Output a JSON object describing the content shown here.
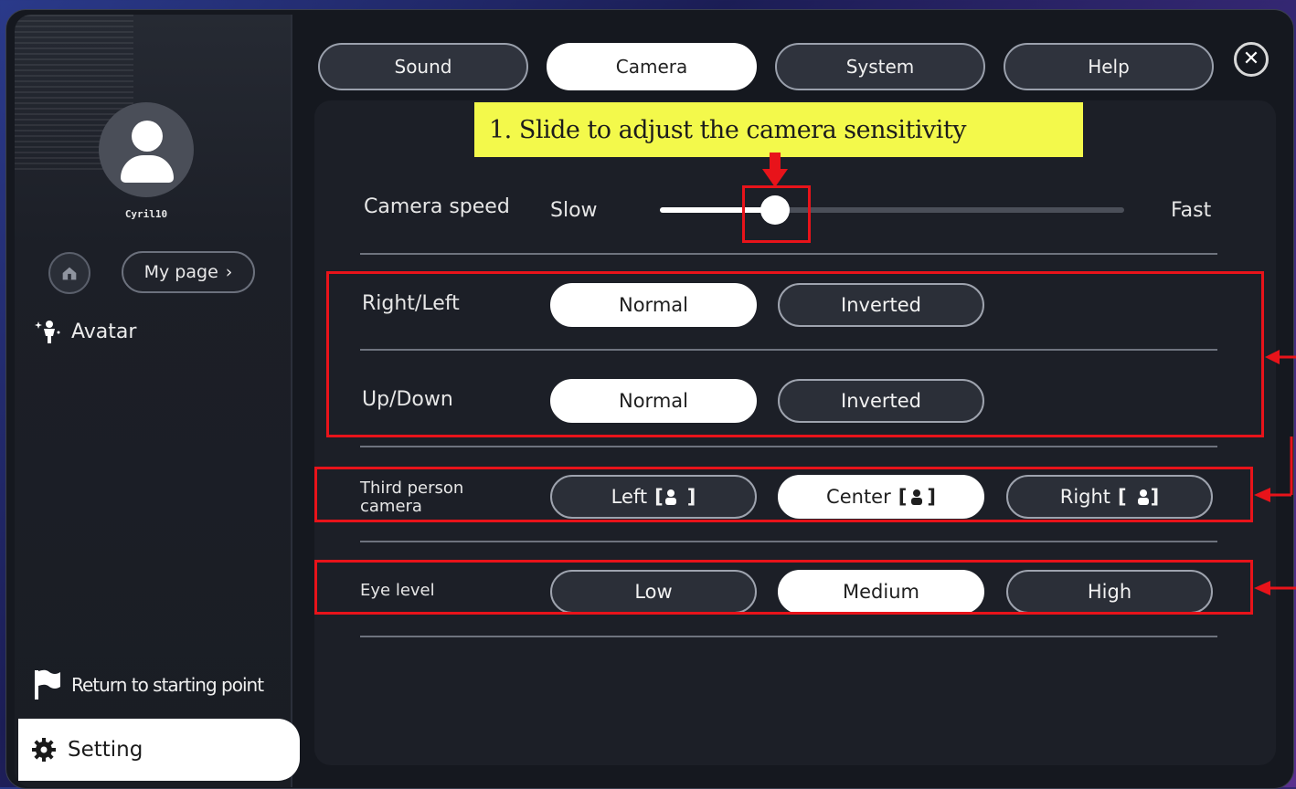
{
  "sidebar": {
    "username": "Cyril10",
    "mypage_label": "My page",
    "mypage_chevron": "›",
    "avatar_label": "Avatar",
    "return_label": "Return to starting point",
    "setting_label": "Setting",
    "icons": [
      "user-avatar-icon",
      "home-icon",
      "chevron-right-icon",
      "avatar-sparkle-icon",
      "flag-icon",
      "gear-icon"
    ]
  },
  "tabs": [
    {
      "label": "Sound",
      "active": false
    },
    {
      "label": "Camera",
      "active": true
    },
    {
      "label": "System",
      "active": false
    },
    {
      "label": "Help",
      "active": false
    }
  ],
  "close_glyph": "✕",
  "annotation": {
    "callout_text": "1. Slide to adjust the camera sensitivity",
    "highlight_color": "#f3f94b",
    "box_color": "#e8131a"
  },
  "camera": {
    "speed": {
      "label": "Camera speed",
      "min_label": "Slow",
      "max_label": "Fast",
      "value": 0.25
    },
    "right_left": {
      "label": "Right/Left",
      "options": [
        "Normal",
        "Inverted"
      ],
      "selected": "Normal"
    },
    "up_down": {
      "label": "Up/Down",
      "options": [
        "Normal",
        "Inverted"
      ],
      "selected": "Normal"
    },
    "third_person": {
      "label_line1": "Third person",
      "label_line2": "camera",
      "options": [
        {
          "label": "Left",
          "bracket_open": "[",
          "bracket_close": "]"
        },
        {
          "label": "Center",
          "bracket_open": "[",
          "bracket_close": "]"
        },
        {
          "label": "Right",
          "bracket_open": "[",
          "bracket_close": "]"
        }
      ],
      "selected": "Center"
    },
    "eye_level": {
      "label": "Eye level",
      "options": [
        "Low",
        "Medium",
        "High"
      ],
      "selected": "Medium"
    }
  }
}
